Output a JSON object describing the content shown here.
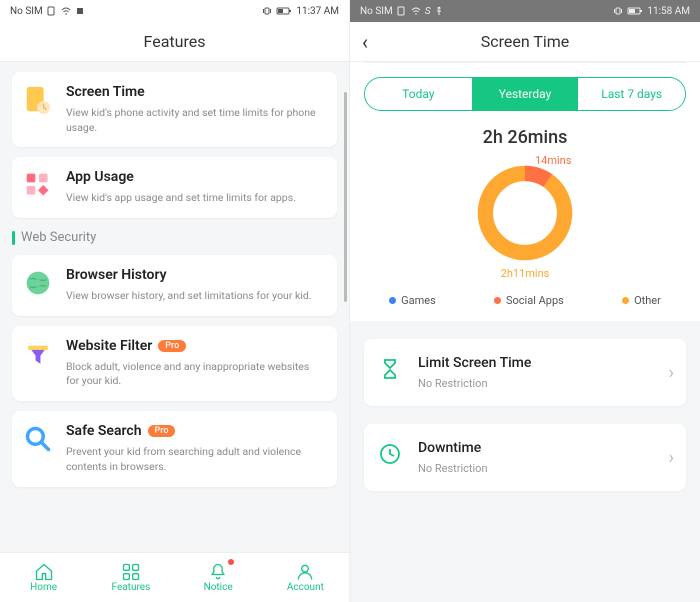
{
  "left": {
    "statusbar": {
      "carrier": "No SIM",
      "time": "11:37 AM"
    },
    "header_title": "Features",
    "section_label": "Web Security",
    "cards": [
      {
        "title": "Screen Time",
        "desc": "View kid's phone activity and set time limits for phone usage.",
        "pro": false
      },
      {
        "title": "App Usage",
        "desc": "View kid's app usage and set time limits for apps.",
        "pro": false
      },
      {
        "title": "Browser History",
        "desc": "View browser history, and set limitations for your kid.",
        "pro": false
      },
      {
        "title": "Website Filter",
        "desc": "Block adult, violence and any inappropriate websites for your kid.",
        "pro": true
      },
      {
        "title": "Safe Search",
        "desc": "Prevent your kid from searching adult and violence contents in browsers.",
        "pro": true
      }
    ],
    "pro_label": "Pro",
    "nav": {
      "home": "Home",
      "features": "Features",
      "notice": "Notice",
      "account": "Account"
    }
  },
  "right": {
    "statusbar": {
      "carrier": "No SIM",
      "extra": "S",
      "time": "11:58 AM"
    },
    "header_title": "Screen Time",
    "tabs": {
      "today": "Today",
      "yesterday": "Yesterday",
      "last7": "Last 7 days"
    },
    "total_time": "2h 26mins",
    "segment_top": "14mins",
    "segment_bot": "2h11mins",
    "legend": {
      "games": "Games",
      "social": "Social Apps",
      "other": "Other"
    },
    "legend_colors": {
      "games": "#3b82f6",
      "social": "#ff7043",
      "other": "#ffa831"
    },
    "lcards": {
      "limit_title": "Limit Screen Time",
      "limit_sub": "No Restriction",
      "down_title": "Downtime",
      "down_sub": "No Restriction"
    }
  },
  "chart_data": {
    "type": "pie",
    "title": "Screen Time (Yesterday)",
    "series": [
      {
        "name": "Social Apps",
        "value_minutes": 14,
        "label": "14mins",
        "color": "#ff7043"
      },
      {
        "name": "Other",
        "value_minutes": 131,
        "label": "2h11mins",
        "color": "#ffa831"
      },
      {
        "name": "Games",
        "value_minutes": 0,
        "label": "",
        "color": "#3b82f6"
      }
    ],
    "total_label": "2h 26mins",
    "total_minutes": 146
  }
}
